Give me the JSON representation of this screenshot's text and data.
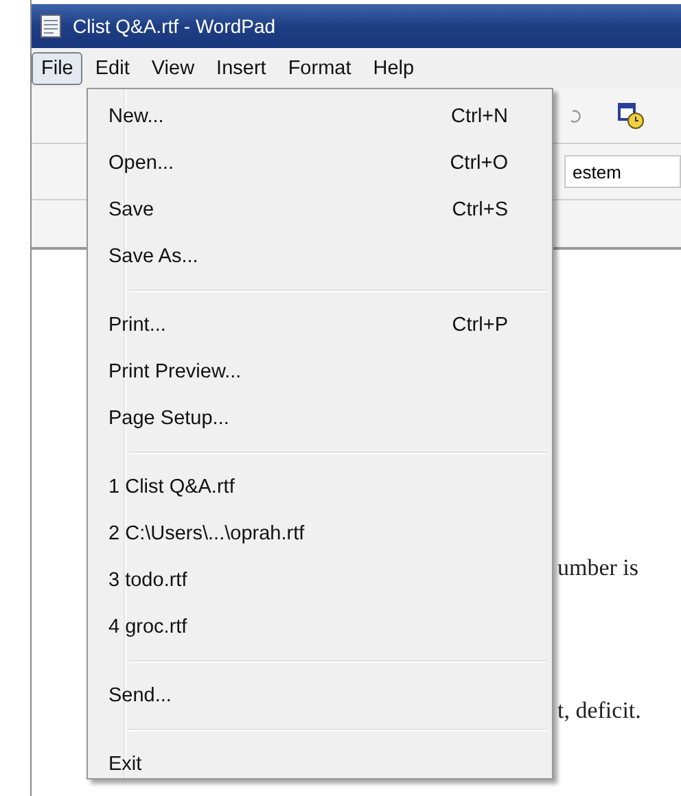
{
  "window": {
    "title": "Clist Q&A.rtf - WordPad"
  },
  "menu_bar": [
    {
      "label": "File",
      "selected": true
    },
    {
      "label": "Edit",
      "selected": false
    },
    {
      "label": "View",
      "selected": false
    },
    {
      "label": "Insert",
      "selected": false
    },
    {
      "label": "Format",
      "selected": false
    },
    {
      "label": "Help",
      "selected": false
    }
  ],
  "format_bar": {
    "font_script": "estem"
  },
  "document": {
    "lines": [
      "umber is",
      "t, deficit."
    ]
  },
  "file_menu": [
    {
      "kind": "item",
      "label": "New...",
      "shortcut": "Ctrl+N"
    },
    {
      "kind": "item",
      "label": "Open...",
      "shortcut": "Ctrl+O"
    },
    {
      "kind": "item",
      "label": "Save",
      "shortcut": "Ctrl+S"
    },
    {
      "kind": "item",
      "label": "Save As..."
    },
    {
      "kind": "separator"
    },
    {
      "kind": "item",
      "label": "Print...",
      "shortcut": "Ctrl+P"
    },
    {
      "kind": "item",
      "label": "Print Preview..."
    },
    {
      "kind": "item",
      "label": "Page Setup..."
    },
    {
      "kind": "separator"
    },
    {
      "kind": "item",
      "label": "1 Clist Q&A.rtf"
    },
    {
      "kind": "item",
      "label": "2 C:\\Users\\...\\oprah.rtf"
    },
    {
      "kind": "item",
      "label": "3 todo.rtf"
    },
    {
      "kind": "item",
      "label": "4 groc.rtf"
    },
    {
      "kind": "separator"
    },
    {
      "kind": "item",
      "label": "Send..."
    },
    {
      "kind": "separator"
    },
    {
      "kind": "item",
      "label": "Exit"
    }
  ]
}
